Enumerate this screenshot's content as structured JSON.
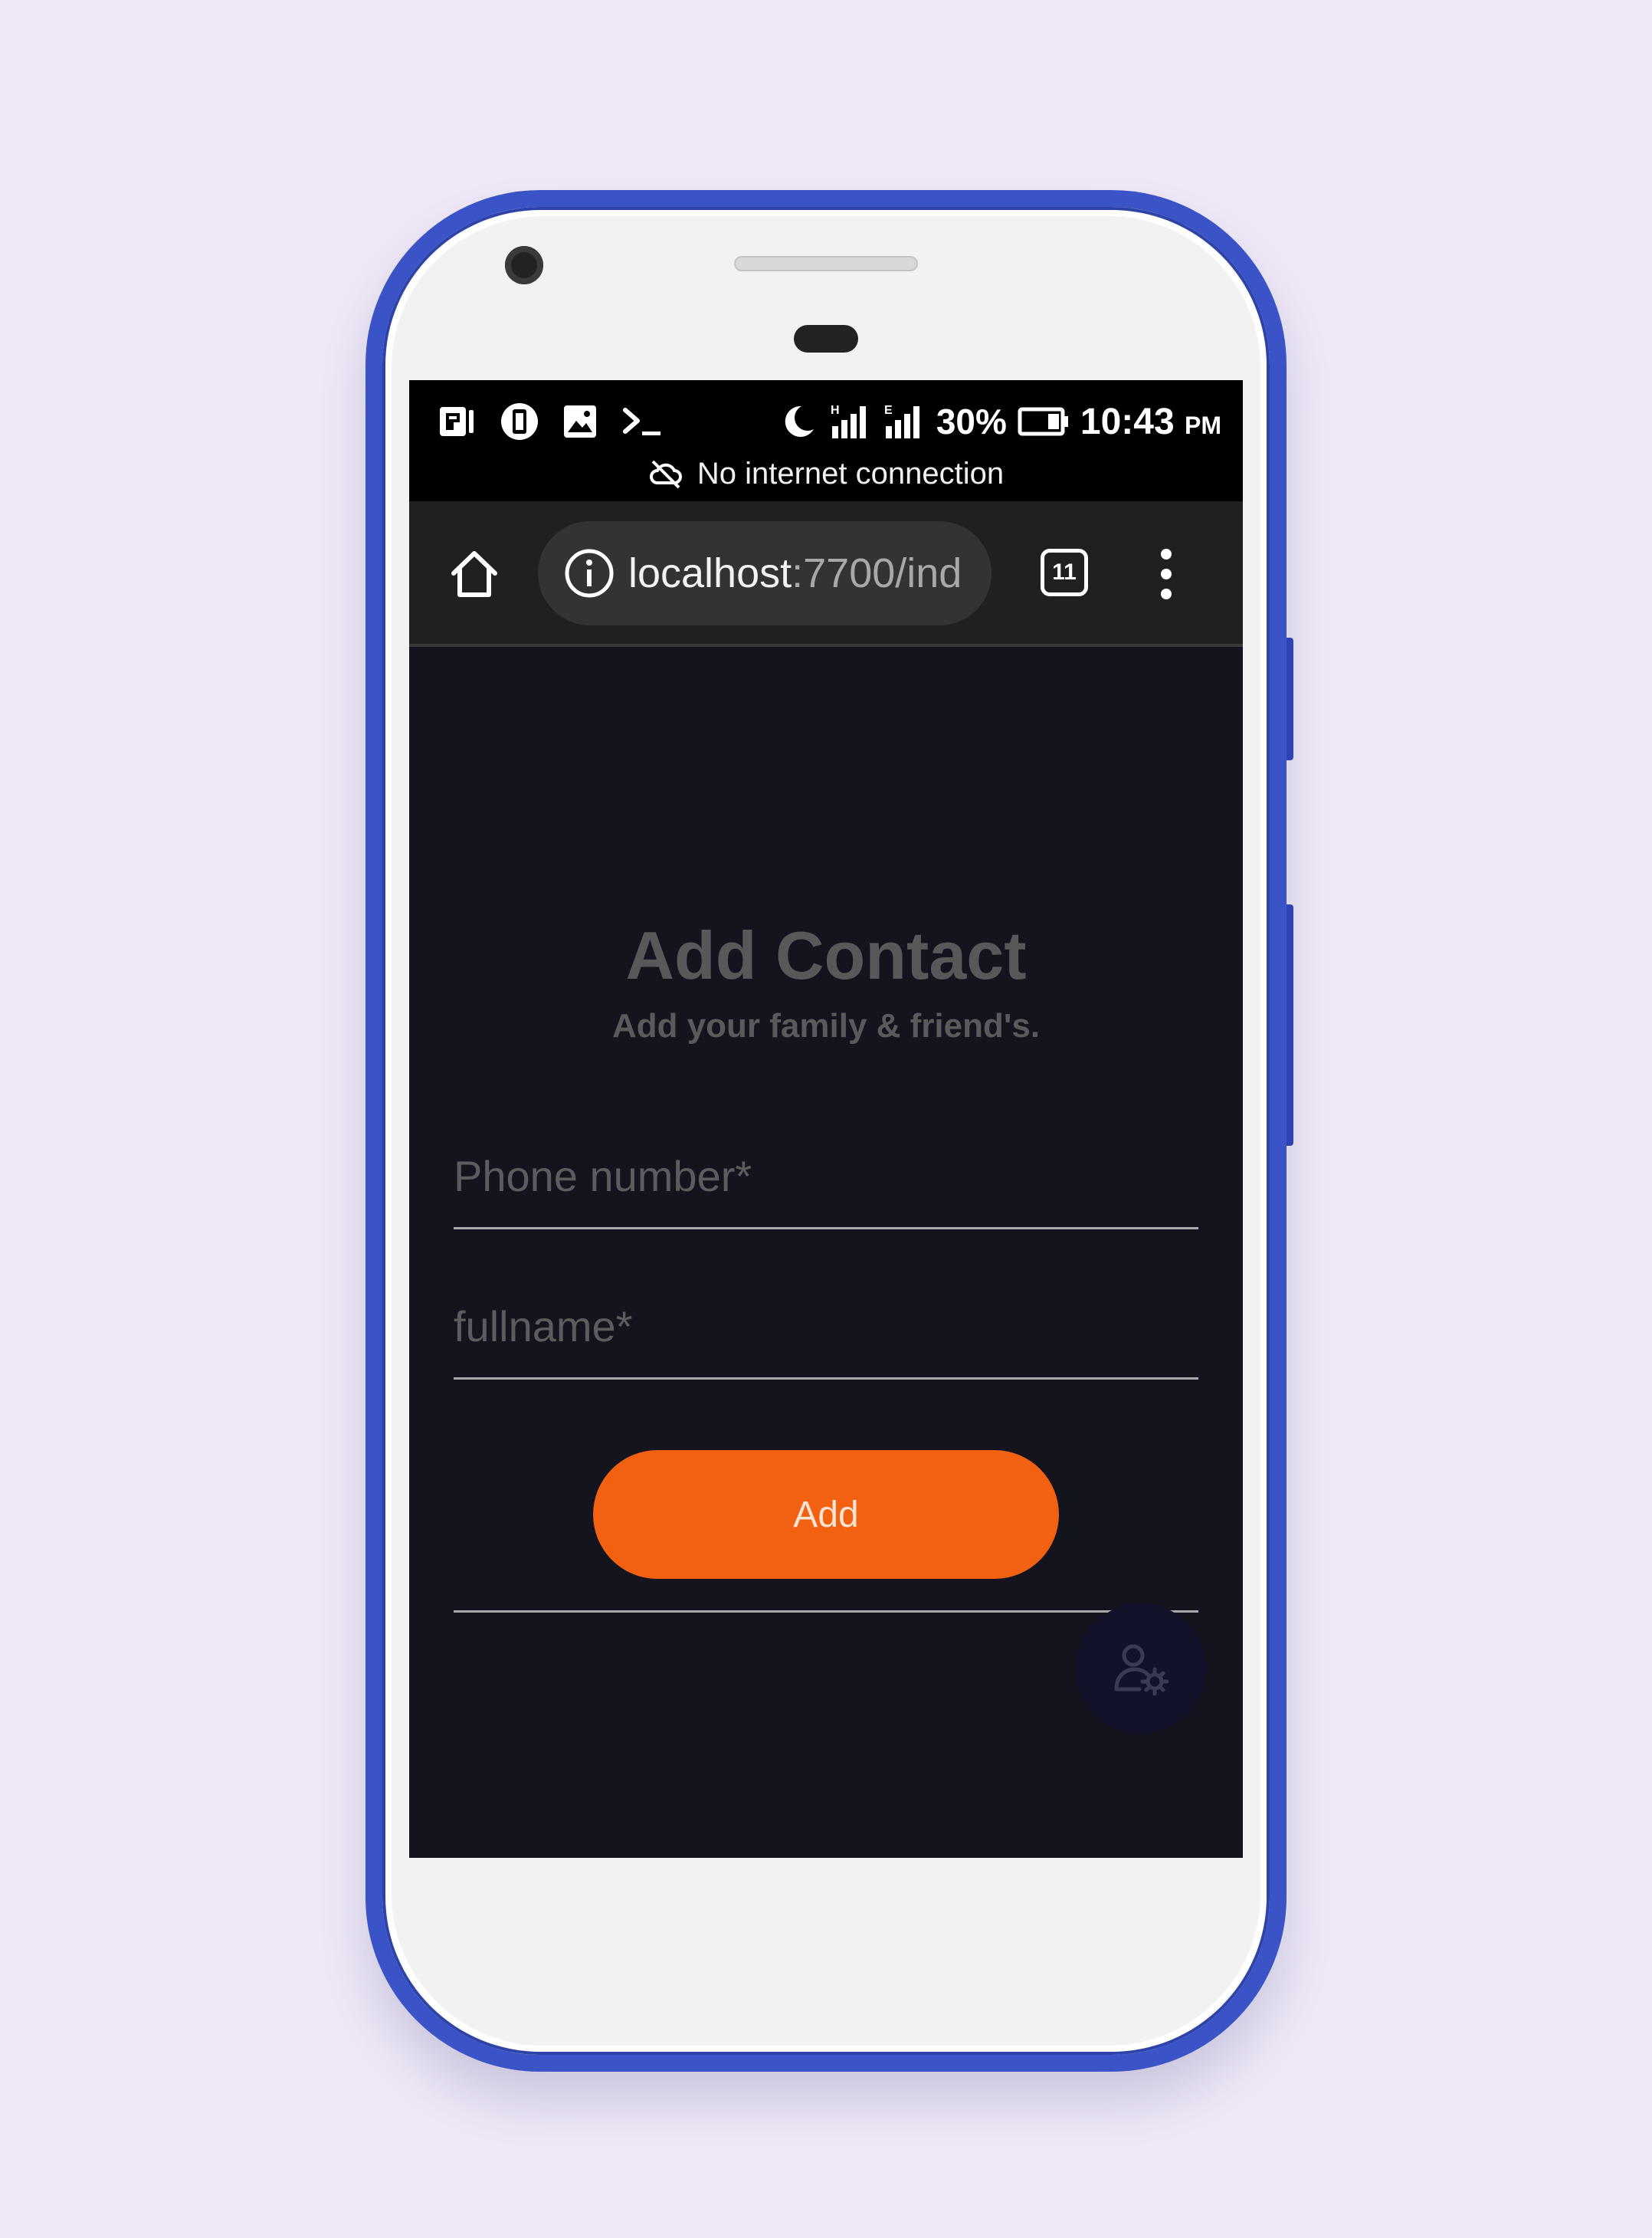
{
  "status_bar": {
    "battery": "30%",
    "time": "10:43",
    "time_suffix": "PM",
    "notice": "No internet connection",
    "left_icons": [
      "pocket-icon",
      "screenshot-icon",
      "image-icon",
      "terminal-icon"
    ],
    "right_icons": [
      "moon-icon",
      "signal-h-icon",
      "signal-e-icon",
      "battery-icon"
    ]
  },
  "browser": {
    "url_host": "localhost",
    "url_path": ":7700/ind",
    "tab_count": "11",
    "icons": [
      "home-icon",
      "info-icon",
      "tabs-icon",
      "more-vert-icon"
    ]
  },
  "page": {
    "title": "Add Contact",
    "subtitle": "Add your family & friend's.",
    "phone_placeholder": "Phone number*",
    "fullname_placeholder": "fullname*",
    "add_label": "Add",
    "fab_icon": "user-settings-icon"
  },
  "colors": {
    "background": "#ede7f6",
    "phone_frame": "#3a53c6",
    "screen_bg": "#14141f",
    "accent": "#f26012"
  }
}
